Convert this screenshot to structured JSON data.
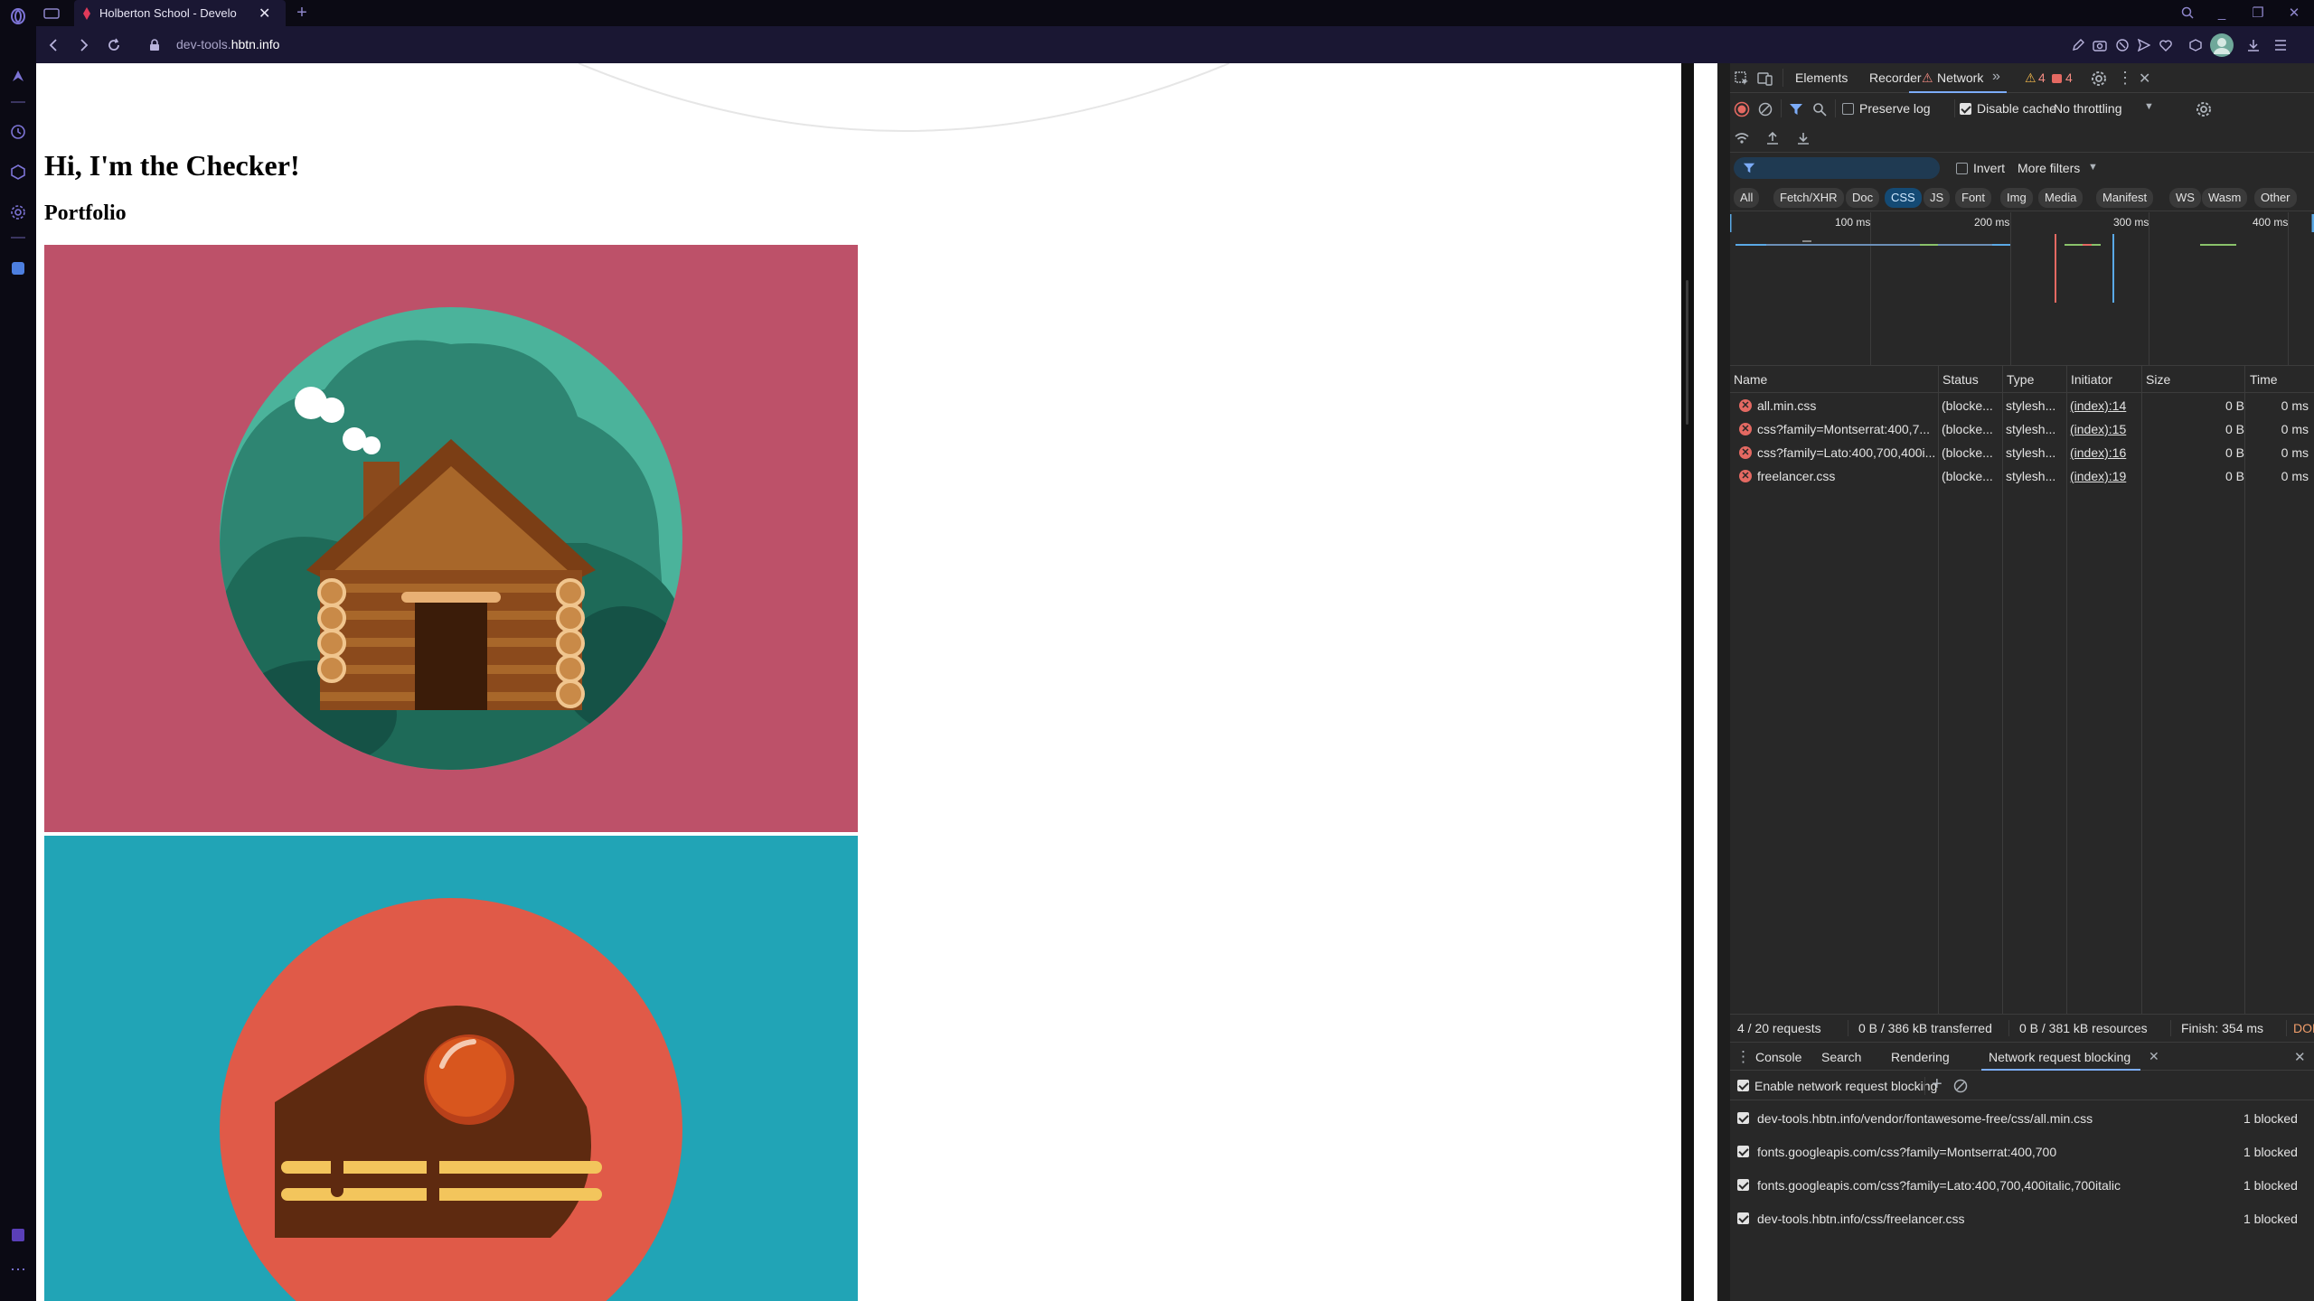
{
  "browser": {
    "tab_title": "Holberton School - Develo",
    "url_prefix": "dev-tools.",
    "url_domain": "hbtn.info"
  },
  "page": {
    "heading": "Hi, I'm the Checker!",
    "subheading": "Portfolio",
    "colors": {
      "cabin_bg": "#bd5169",
      "cake_bg": "#21a4b6"
    }
  },
  "devtools": {
    "tabs": {
      "elements": "Elements",
      "recorder": "Recorder",
      "network": "Network",
      "warnings": "4",
      "errors": "4"
    },
    "toolbar": {
      "preserve_log": "Preserve log",
      "disable_cache": "Disable cache",
      "throttling": "No throttling"
    },
    "filter": {
      "invert": "Invert",
      "more_filters": "More filters"
    },
    "types": [
      "All",
      "Fetch/XHR",
      "Doc",
      "CSS",
      "JS",
      "Font",
      "Img",
      "Media",
      "Manifest",
      "WS",
      "Wasm",
      "Other"
    ],
    "active_type": "CSS",
    "timeline_ticks": [
      "100 ms",
      "200 ms",
      "300 ms",
      "400 ms"
    ],
    "columns": {
      "name": "Name",
      "status": "Status",
      "type": "Type",
      "initiator": "Initiator",
      "size": "Size",
      "time": "Time"
    },
    "requests": [
      {
        "name": "all.min.css",
        "status": "(blocke...",
        "type": "stylesh...",
        "initiator": "(index):14",
        "size": "0 B",
        "time": "0 ms"
      },
      {
        "name": "css?family=Montserrat:400,7...",
        "status": "(blocke...",
        "type": "stylesh...",
        "initiator": "(index):15",
        "size": "0 B",
        "time": "0 ms"
      },
      {
        "name": "css?family=Lato:400,700,400i...",
        "status": "(blocke...",
        "type": "stylesh...",
        "initiator": "(index):16",
        "size": "0 B",
        "time": "0 ms"
      },
      {
        "name": "freelancer.css",
        "status": "(blocke...",
        "type": "stylesh...",
        "initiator": "(index):19",
        "size": "0 B",
        "time": "0 ms"
      }
    ],
    "status_bar": {
      "requests": "4 / 20 requests",
      "transferred": "0 B / 386 kB transferred",
      "resources": "0 B / 381 kB resources",
      "finish": "Finish: 354 ms",
      "dom": "DOMC"
    },
    "drawer_tabs": {
      "console": "Console",
      "search": "Search",
      "rendering": "Rendering",
      "blocking": "Network request blocking"
    },
    "blocking": {
      "enable_label": "Enable network request blocking",
      "patterns": [
        {
          "url": "dev-tools.hbtn.info/vendor/fontawesome-free/css/all.min.css",
          "count": "1 blocked"
        },
        {
          "url": "fonts.googleapis.com/css?family=Montserrat:400,700",
          "count": "1 blocked"
        },
        {
          "url": "fonts.googleapis.com/css?family=Lato:400,700,400italic,700italic",
          "count": "1 blocked"
        },
        {
          "url": "dev-tools.hbtn.info/css/freelancer.css",
          "count": "1 blocked"
        }
      ]
    },
    "colors": {
      "accent": "#7cacf8",
      "error": "#e46962",
      "warning": "#f28b82"
    }
  }
}
